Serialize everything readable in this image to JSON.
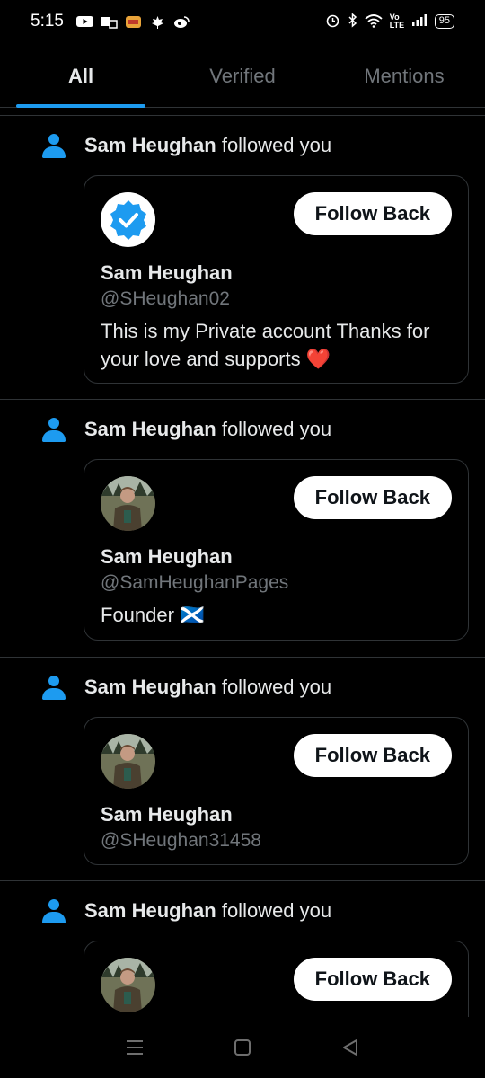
{
  "status": {
    "time": "5:15",
    "battery": "95",
    "network": "Vo LTE"
  },
  "tabs": [
    {
      "label": "All",
      "active": true
    },
    {
      "label": "Verified",
      "active": false
    },
    {
      "label": "Mentions",
      "active": false
    }
  ],
  "notifications": [
    {
      "actor": "Sam Heughan",
      "action": "followed you",
      "name": "Sam Heughan",
      "handle": "@SHeughan02",
      "bio": "This is my Private account Thanks for your love and supports ❤️",
      "button": "Follow Back",
      "avatar": "verified-badge-icon"
    },
    {
      "actor": "Sam Heughan",
      "action": "followed you",
      "name": "Sam Heughan",
      "handle": "@SamHeughanPages",
      "bio": "Founder 🏴󠁧󠁢󠁳󠁣󠁴󠁿",
      "button": "Follow Back",
      "avatar": "photo"
    },
    {
      "actor": "Sam Heughan",
      "action": "followed you",
      "name": "Sam Heughan",
      "handle": "@SHeughan31458",
      "bio": "",
      "button": "Follow Back",
      "avatar": "photo"
    },
    {
      "actor": "Sam Heughan",
      "action": "followed you",
      "name": "Sam Heughan",
      "handle": "",
      "bio": "",
      "button": "Follow Back",
      "avatar": "photo"
    }
  ],
  "colors": {
    "accent": "#1d9bf0",
    "background": "#000000",
    "secondary_text": "#71767b",
    "border": "#2f3336"
  }
}
